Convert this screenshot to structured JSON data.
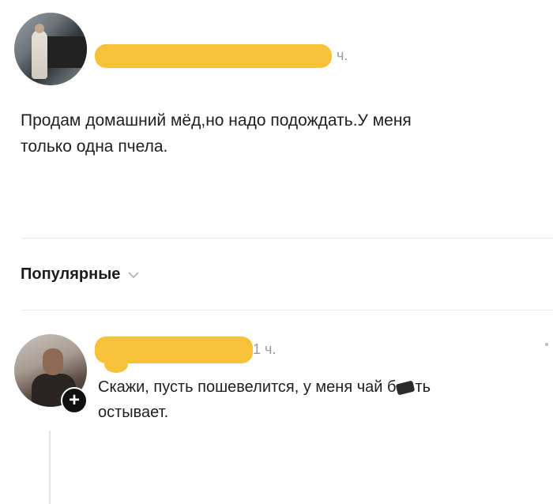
{
  "post": {
    "time_suffix": "ч.",
    "text_line1": "Продам домашний мёд,но надо подождать.У меня",
    "text_line2": "только одна пчела."
  },
  "sort": {
    "label": "Популярные"
  },
  "comment": {
    "time": "1 ч.",
    "text_line1_a": "Скажи, пусть пошевелится, у меня чай б",
    "text_line1_b": "ть",
    "text_line2": "остывает.",
    "add_badge": "+"
  },
  "colors": {
    "redaction": "#f7c23a",
    "text": "#1f1f1f",
    "muted": "#9a9a9a"
  },
  "icons": [
    "chevron-down-icon",
    "plus-icon"
  ]
}
